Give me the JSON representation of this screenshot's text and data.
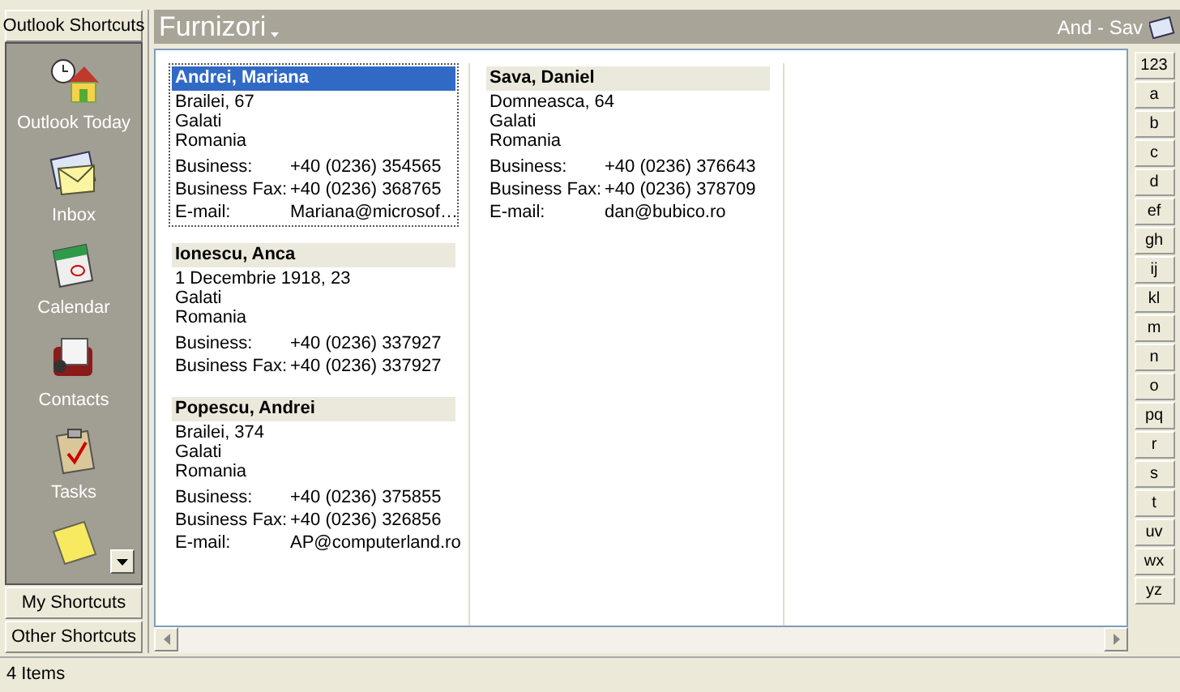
{
  "sidebar": {
    "header": "Outlook Shortcuts",
    "items": [
      {
        "label": "Outlook Today",
        "kind": "today"
      },
      {
        "label": "Inbox",
        "kind": "inbox"
      },
      {
        "label": "Calendar",
        "kind": "calendar"
      },
      {
        "label": "Contacts",
        "kind": "contacts"
      },
      {
        "label": "Tasks",
        "kind": "tasks"
      },
      {
        "kind": "notes"
      }
    ],
    "groups": [
      "My Shortcuts",
      "Other Shortcuts"
    ]
  },
  "folder": {
    "title": "Furnizori",
    "range": "And - Sav"
  },
  "columns": [
    {
      "cards": [
        {
          "name": "Andrei, Mariana",
          "selected": true,
          "address": [
            "Brailei, 67",
            "Galati",
            "Romania"
          ],
          "fields": [
            {
              "label": "Business:",
              "value": "+40 (0236) 354565"
            },
            {
              "label": "Business Fax:",
              "value": "+40 (0236) 368765"
            },
            {
              "label": "E-mail:",
              "value": "Mariana@microsof…"
            }
          ]
        },
        {
          "name": "Ionescu, Anca",
          "selected": false,
          "address": [
            "1 Decembrie 1918, 23",
            "Galati",
            "Romania"
          ],
          "fields": [
            {
              "label": "Business:",
              "value": "+40 (0236) 337927"
            },
            {
              "label": "Business Fax:",
              "value": "+40 (0236) 337927"
            }
          ]
        },
        {
          "name": "Popescu, Andrei",
          "selected": false,
          "address": [
            "Brailei, 374",
            "Galati",
            "Romania"
          ],
          "fields": [
            {
              "label": "Business:",
              "value": "+40 (0236) 375855"
            },
            {
              "label": "Business Fax:",
              "value": "+40 (0236) 326856"
            },
            {
              "label": "E-mail:",
              "value": "AP@computerland.ro"
            }
          ]
        }
      ]
    },
    {
      "cards": [
        {
          "name": "Sava, Daniel",
          "selected": false,
          "address": [
            "Domneasca, 64",
            "Galati",
            "Romania"
          ],
          "fields": [
            {
              "label": "Business:",
              "value": "+40 (0236) 376643"
            },
            {
              "label": "Business Fax:",
              "value": "+40 (0236) 378709"
            },
            {
              "label": "E-mail:",
              "value": "dan@bubico.ro"
            }
          ]
        }
      ]
    }
  ],
  "index": [
    "123",
    "a",
    "b",
    "c",
    "d",
    "ef",
    "gh",
    "ij",
    "kl",
    "m",
    "n",
    "o",
    "pq",
    "r",
    "s",
    "t",
    "uv",
    "wx",
    "yz"
  ],
  "status_bar": "4 Items"
}
